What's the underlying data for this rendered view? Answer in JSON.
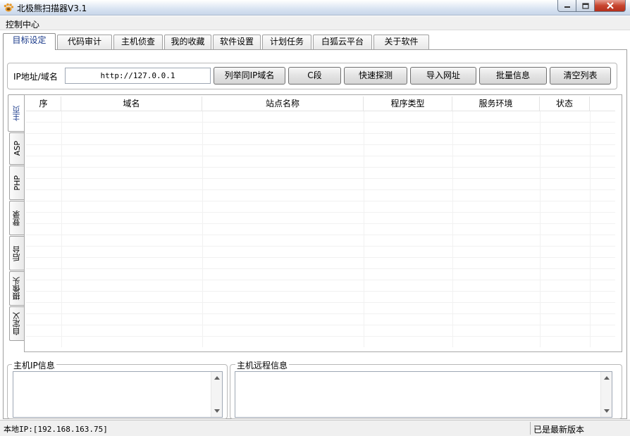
{
  "window": {
    "title": "北极熊扫描器V3.1",
    "icon": "bear-paw-icon",
    "controls": [
      "minimize-icon",
      "maximize-icon",
      "close-icon"
    ]
  },
  "menu": {
    "items": [
      "控制中心"
    ]
  },
  "main_tabs": {
    "items": [
      "目标设定",
      "代码审计",
      "主机侦查",
      "我的收藏",
      "软件设置",
      "计划任务",
      "白狐云平台",
      "关于软件"
    ],
    "active": "目标设定"
  },
  "target": {
    "ip_label": "IP地址/域名",
    "ip_value": "http://127.0.0.1",
    "buttons": [
      "列举同IP域名",
      "C段",
      "快速探测",
      "导入网址",
      "批量信息",
      "清空列表"
    ]
  },
  "side_tabs": {
    "items": [
      "主页",
      "ASP",
      "PHP",
      "登录",
      "后台",
      "摄像头",
      "自定义"
    ],
    "active": "主页"
  },
  "table": {
    "columns": [
      "序",
      "域名",
      "站点名称",
      "程序类型",
      "服务环境",
      "状态"
    ],
    "rows": []
  },
  "host_ip_info": {
    "label": "主机IP信息",
    "value": ""
  },
  "host_remote_info": {
    "label": "主机远程信息",
    "value": ""
  },
  "status": {
    "local_ip": "本地IP:[192.168.163.75]",
    "version": "已是最新版本"
  },
  "colors": {
    "active_tab_text": "#1a3a8a",
    "close_button": "#c7452f"
  }
}
